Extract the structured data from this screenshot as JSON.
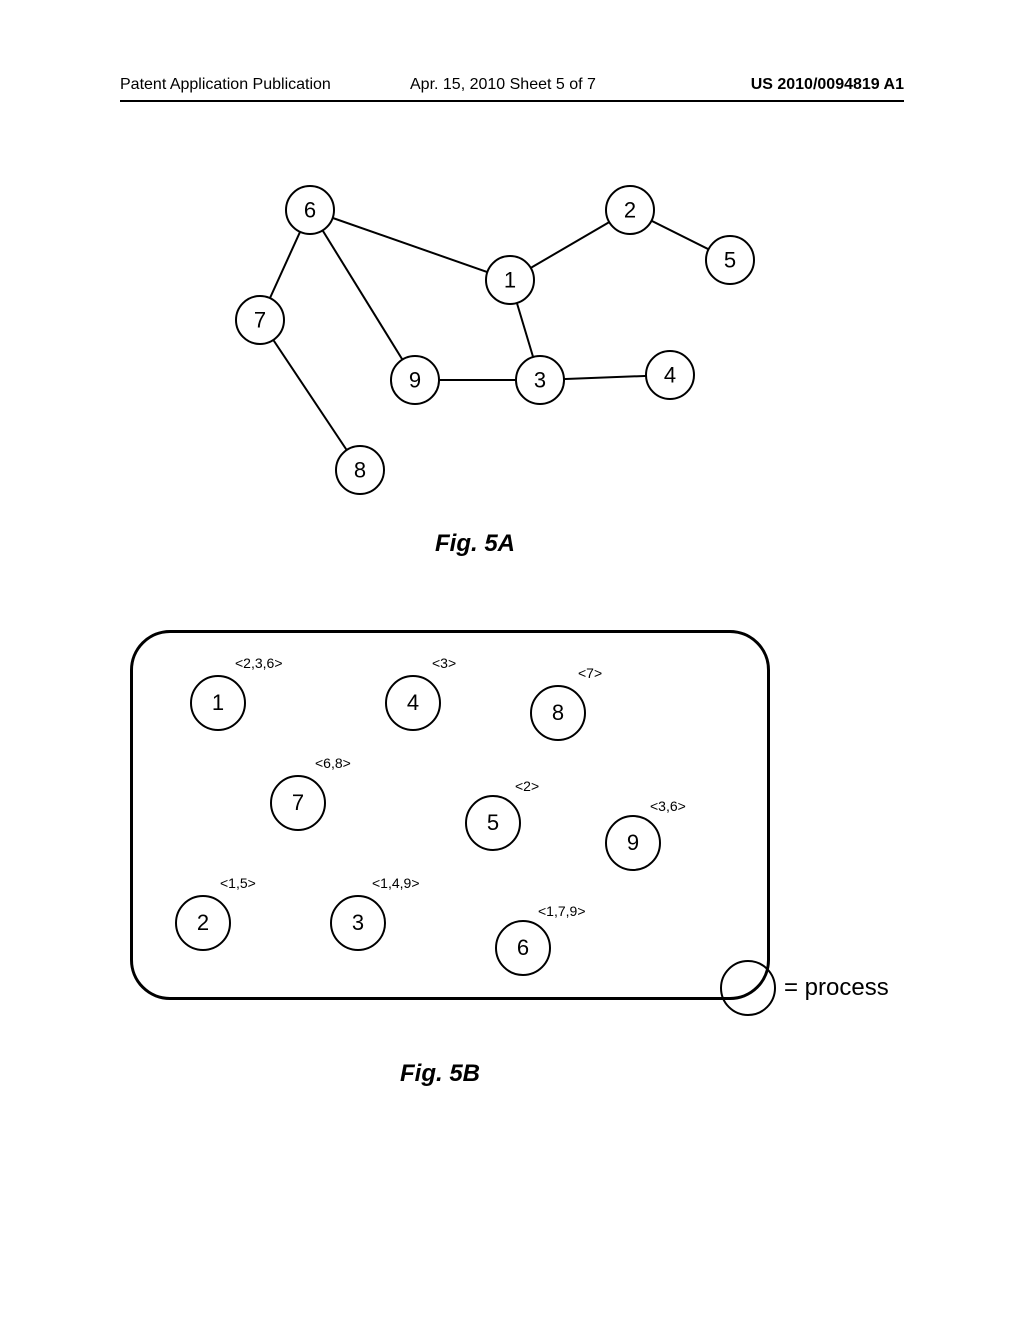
{
  "header": {
    "left": "Patent Application Publication",
    "center": "Apr. 15, 2010  Sheet 5 of 7",
    "right": "US 2010/0094819 A1"
  },
  "fig5a": {
    "caption": "Fig. 5A",
    "nodes": {
      "n1": "1",
      "n2": "2",
      "n3": "3",
      "n4": "4",
      "n5": "5",
      "n6": "6",
      "n7": "7",
      "n8": "8",
      "n9": "9"
    }
  },
  "fig5b": {
    "caption": "Fig. 5B",
    "legend_text": "= process",
    "processes": {
      "p1": {
        "id": "1",
        "label": "<2,3,6>"
      },
      "p4": {
        "id": "4",
        "label": "<3>"
      },
      "p8": {
        "id": "8",
        "label": "<7>"
      },
      "p7": {
        "id": "7",
        "label": "<6,8>"
      },
      "p5": {
        "id": "5",
        "label": "<2>"
      },
      "p9": {
        "id": "9",
        "label": "<3,6>"
      },
      "p2": {
        "id": "2",
        "label": "<1,5>"
      },
      "p3": {
        "id": "3",
        "label": "<1,4,9>"
      },
      "p6": {
        "id": "6",
        "label": "<1,7,9>"
      }
    }
  },
  "chart_data": [
    {
      "type": "graph",
      "title": "Fig. 5A",
      "nodes": [
        1,
        2,
        3,
        4,
        5,
        6,
        7,
        8,
        9
      ],
      "edges": [
        [
          6,
          7
        ],
        [
          6,
          9
        ],
        [
          6,
          1
        ],
        [
          7,
          8
        ],
        [
          9,
          3
        ],
        [
          1,
          3
        ],
        [
          1,
          2
        ],
        [
          3,
          4
        ],
        [
          2,
          5
        ]
      ]
    },
    {
      "type": "process-set",
      "title": "Fig. 5B",
      "legend": "circle = process",
      "processes": [
        {
          "id": 1,
          "neighbors": [
            2,
            3,
            6
          ]
        },
        {
          "id": 2,
          "neighbors": [
            1,
            5
          ]
        },
        {
          "id": 3,
          "neighbors": [
            1,
            4,
            9
          ]
        },
        {
          "id": 4,
          "neighbors": [
            3
          ]
        },
        {
          "id": 5,
          "neighbors": [
            2
          ]
        },
        {
          "id": 6,
          "neighbors": [
            1,
            7,
            9
          ]
        },
        {
          "id": 7,
          "neighbors": [
            6,
            8
          ]
        },
        {
          "id": 8,
          "neighbors": [
            7
          ]
        },
        {
          "id": 9,
          "neighbors": [
            3,
            6
          ]
        }
      ]
    }
  ]
}
